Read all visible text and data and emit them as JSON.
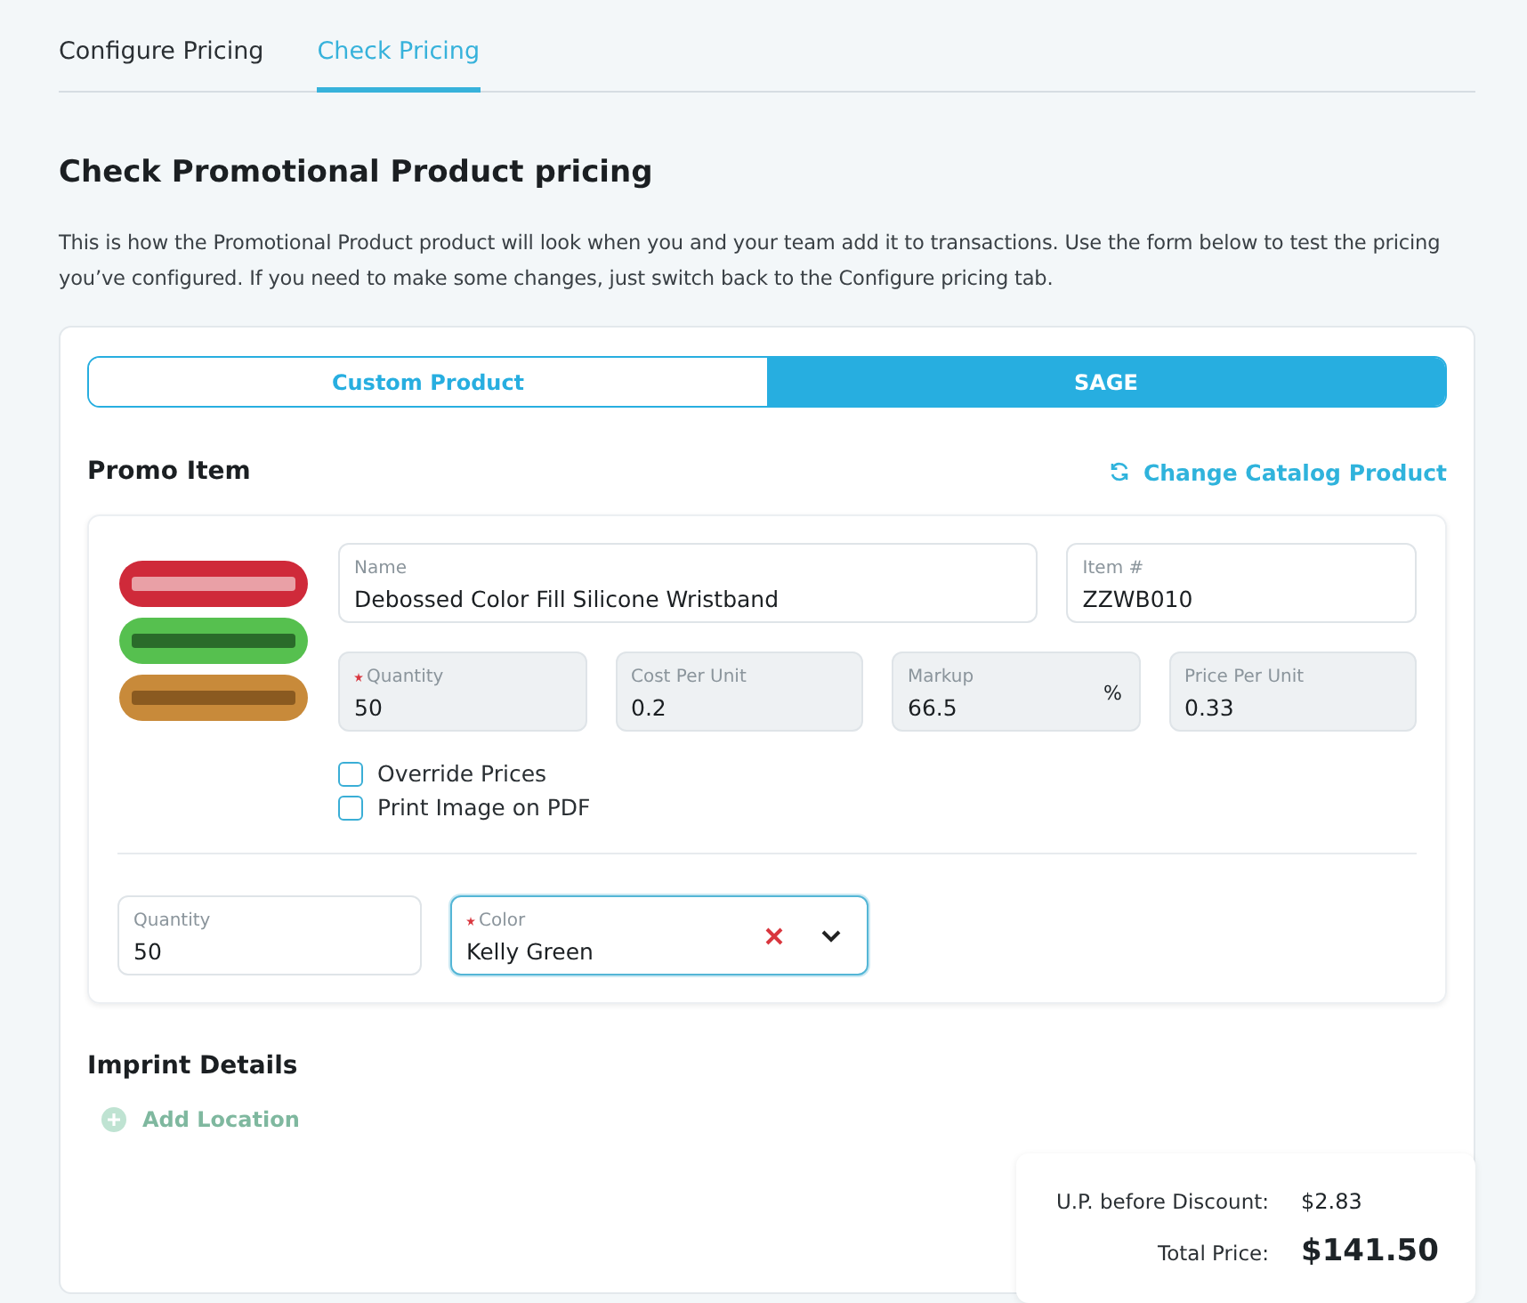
{
  "tabs": [
    {
      "label": "Configure Pricing",
      "selected": false
    },
    {
      "label": "Check Pricing",
      "selected": true
    }
  ],
  "heading": "Check Promotional Product pricing",
  "description": "This is how the Promotional Product product will look when you and your team add it to transactions. Use the form below to test the pricing you’ve configured. If you need to make some changes, just switch back to the Configure pricing tab.",
  "product_type": [
    {
      "label": "Custom Product",
      "selected": false
    },
    {
      "label": "SAGE",
      "selected": true
    }
  ],
  "promo_item": {
    "title": "Promo Item",
    "change_link": "Change Catalog Product",
    "fields_row_1": [
      {
        "label": "Name",
        "value": "Debossed Color Fill Silicone Wristband",
        "required": false,
        "disabled": false
      },
      {
        "label": "Item #",
        "value": "ZZWB010",
        "required": false,
        "disabled": false
      }
    ],
    "fields_row_2": [
      {
        "label": "Quantity",
        "value": "50",
        "required": true,
        "disabled": true
      },
      {
        "label": "Cost Per Unit",
        "value": "0.2",
        "required": false,
        "disabled": true
      },
      {
        "label": "Markup",
        "value": "66.5",
        "suffix": "%",
        "required": false,
        "disabled": true
      },
      {
        "label": "Price Per Unit",
        "value": "0.33",
        "required": false,
        "disabled": true
      }
    ],
    "checkboxes": [
      {
        "label": "Override Prices",
        "checked": false
      },
      {
        "label": "Print Image on PDF",
        "checked": false
      }
    ],
    "options": [
      {
        "kind": "text",
        "label": "Quantity",
        "value": "50",
        "required": false,
        "focused": false
      },
      {
        "kind": "select",
        "label": "Color",
        "value": "Kelly Green",
        "required": true,
        "focused": true
      }
    ]
  },
  "imprint": {
    "title": "Imprint Details",
    "add_button": "Add Location"
  },
  "totals": [
    {
      "label": "U.P. before Discount:",
      "value": "$2.83",
      "emphasis": false
    },
    {
      "label": "Total Price:",
      "value": "$141.50",
      "emphasis": true
    }
  ]
}
